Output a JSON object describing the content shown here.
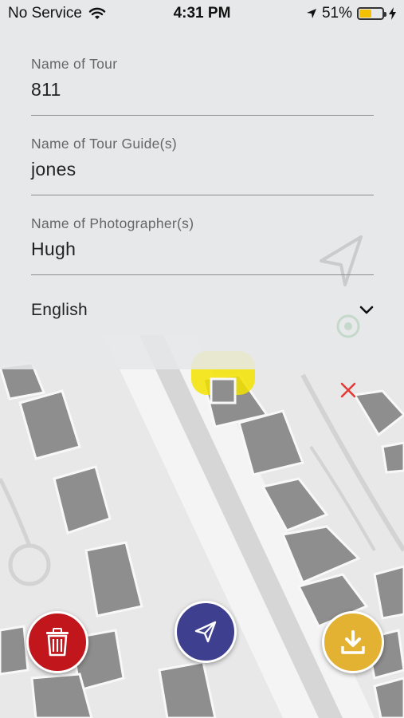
{
  "status": {
    "carrier": "No Service",
    "time": "4:31 PM",
    "battery": "51%",
    "battery_level": 0.51,
    "battery_color": "#f2c200"
  },
  "form": {
    "tour_name": {
      "label": "Name of Tour",
      "value": "811"
    },
    "guide_name": {
      "label": "Name of Tour Guide(s)",
      "value": "jones"
    },
    "photographer_name": {
      "label": "Name of Photographer(s)",
      "value": "Hugh"
    },
    "language": {
      "selected": "English"
    }
  },
  "buttons": {
    "delete": {
      "icon": "trash-icon",
      "color": "#c0161c"
    },
    "send": {
      "icon": "send-icon",
      "color": "#3e3f8f"
    },
    "download": {
      "icon": "download-icon",
      "color": "#e3b232"
    }
  },
  "map": {
    "marker_color": "#f3e300",
    "close_marker_color": "#e53935"
  }
}
